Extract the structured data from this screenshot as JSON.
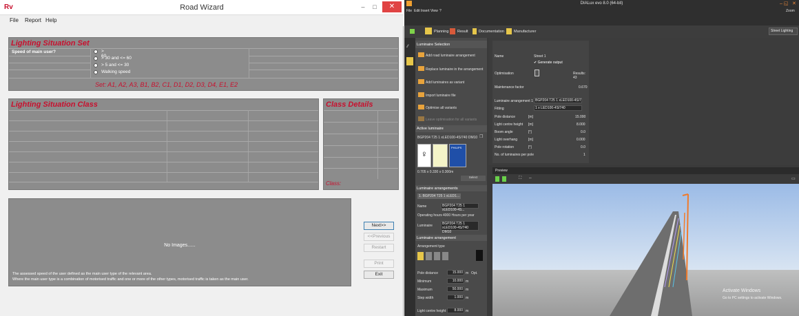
{
  "road_wizard": {
    "logo": "Rv",
    "title": "Road Wizard",
    "window_buttons": {
      "minimize": "–",
      "maximize": "□",
      "close": "✕"
    },
    "menu": [
      "File",
      "Report",
      "Help"
    ],
    "lighting_situation_set": {
      "title": "Lighting Situation Set",
      "question": "Speed of main user?",
      "options": [
        "> 60",
        "> 30 and <= 60",
        "> 5 and <= 30",
        "Walking speed"
      ],
      "sets": "Set: A1, A2, A3, B1, B2, C1, D1, D2, D3, D4, E1, E2"
    },
    "lighting_situation_class": {
      "title": "Lighting Situation Class"
    },
    "class_details": {
      "title": "Class Details",
      "class_label": "Class:"
    },
    "images": {
      "placeholder": "No Images......"
    },
    "description": [
      "The assessed speed of the user defined as the main user type of the relevant area.",
      "Where the main user type is a combination of motorised traffic and one or more of the other types, motorised traffic is taken as the main user."
    ],
    "buttons": {
      "next": "Next>>",
      "previous": "<<Previous",
      "restart": "Restart",
      "print": "Print",
      "exit": "Exit"
    }
  },
  "dialux": {
    "title": "DIALux evo 8.0 (64-bit)",
    "menu": [
      "File",
      "Edit",
      "Insert",
      "View",
      "?"
    ],
    "zoom_label": "Zoom",
    "tabs": [
      "Planning",
      "Result",
      "Documentation",
      "Manufacturer"
    ],
    "mode_select": "Street Lighting",
    "luminaire_selection": {
      "header": "Luminaire Selection",
      "items": [
        "Add road luminaire arrangement",
        "Replace luminaire in the arrangement",
        "Add luminaires as variant",
        "Import luminaire file",
        "Optimise all variants",
        "Leave optimisation for all variants"
      ]
    },
    "active_luminaire": {
      "header": "Active luminaire",
      "name": "BGP204 T25 1 xLED100-4S/740 DM10",
      "dimensions": "0.705 x 0.330 x 0.300m",
      "select_btn": "Select",
      "brand": "PHILIPS"
    },
    "luminaire_arrangements": {
      "header": "Luminaire arrangements",
      "tab": "1. BGP204 T25 1 xLED1...",
      "rows": [
        {
          "label": "Name",
          "value": "BGP204 T25 1 xLED100-4S..."
        },
        {
          "label": "Operating hours",
          "value": "4000 Hours per year"
        },
        {
          "label": "Luminaire",
          "value": "BGP204 T25 1 xLED100-4S/740 DM10"
        }
      ]
    },
    "luminaire_arrangement": {
      "header": "Luminaire arrangement",
      "arrangement_type": "Arrangement type",
      "rows": [
        {
          "label": "Pole distance",
          "value": "15.000",
          "unit": "m",
          "extra": "Opt."
        },
        {
          "label": "Minimum",
          "value": "10.000",
          "unit": "m"
        },
        {
          "label": "Maximum",
          "value": "50.000",
          "unit": "m"
        },
        {
          "label": "Step width",
          "value": "1.000",
          "unit": "m"
        },
        {
          "label": "Light centre height",
          "value": "8.000",
          "unit": "m"
        }
      ]
    },
    "properties": {
      "name_label": "Name",
      "name_value": "Street 1",
      "generate_output": "Generate output",
      "optimisation_label": "Optimisation",
      "results_label": "Results: 43",
      "maintenance_label": "Maintenance factor",
      "maintenance_value": "0.670",
      "rows": [
        {
          "label": "Luminaire arrangement 1",
          "unit": "",
          "value": "BGP204 T25 1 xLED100-4S/740 DM10"
        },
        {
          "label": "Fitting",
          "unit": "",
          "value": "1 x LED100-4S/740"
        },
        {
          "label": "Pole distance",
          "unit": "[m]",
          "value": "15.000"
        },
        {
          "label": "Light centre height",
          "unit": "[m]",
          "value": "8.000"
        },
        {
          "label": "Boom angle",
          "unit": "[°]",
          "value": "0.0"
        },
        {
          "label": "Light overhang",
          "unit": "[m]",
          "value": "0.000"
        },
        {
          "label": "Pole rotation",
          "unit": "[°]",
          "value": "0.0"
        },
        {
          "label": "No. of luminaires per pole",
          "unit": "",
          "value": "1"
        }
      ]
    },
    "preview": {
      "header": "Preview"
    },
    "watermark": {
      "title": "Activate Windows",
      "subtitle": "Go to PC settings to activate Windows."
    }
  }
}
